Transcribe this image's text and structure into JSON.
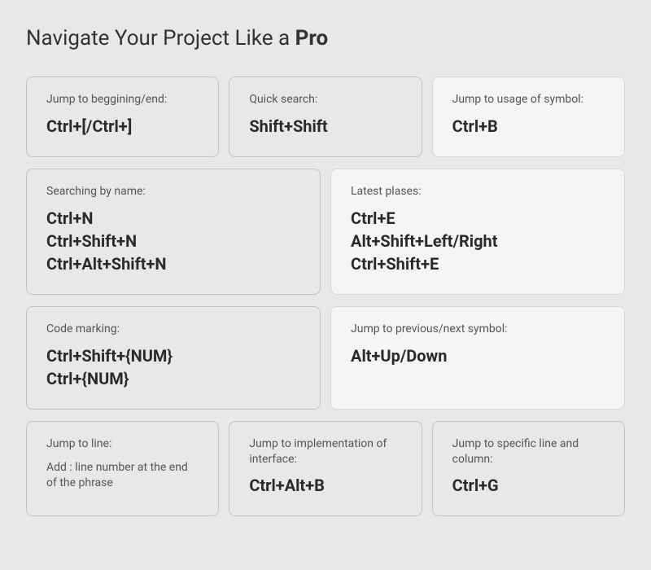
{
  "title_prefix": "Navigate Your Project Like a ",
  "title_bold": "Pro",
  "cards": {
    "jump_begin_end": {
      "label": "Jump to beggining/end:",
      "value": "Ctrl+[/Ctrl+]"
    },
    "quick_search": {
      "label": "Quick search:",
      "value": "Shift+Shift"
    },
    "usage_symbol": {
      "label": "Jump to usage of symbol:",
      "value": "Ctrl+B"
    },
    "search_by_name": {
      "label": "Searching by name:",
      "values": [
        "Ctrl+N",
        "Ctrl+Shift+N",
        "Ctrl+Alt+Shift+N"
      ]
    },
    "latest_places": {
      "label": "Latest plases:",
      "values": [
        "Ctrl+E",
        "Alt+Shift+Left/Right",
        "Ctrl+Shift+E"
      ]
    },
    "code_marking": {
      "label": "Code marking:",
      "values": [
        "Ctrl+Shift+{NUM}",
        "Ctrl+{NUM}"
      ]
    },
    "prev_next_symbol": {
      "label": "Jump to previous/next symbol:",
      "value": "Alt+Up/Down"
    },
    "jump_to_line": {
      "label": "Jump to line:",
      "value": "Add : line number at the end of the phrase"
    },
    "impl_interface": {
      "label": "Jump to implementation of interface:",
      "value": "Ctrl+Alt+B"
    },
    "line_column": {
      "label": "Jump to specific line and column:",
      "value": "Ctrl+G"
    }
  }
}
